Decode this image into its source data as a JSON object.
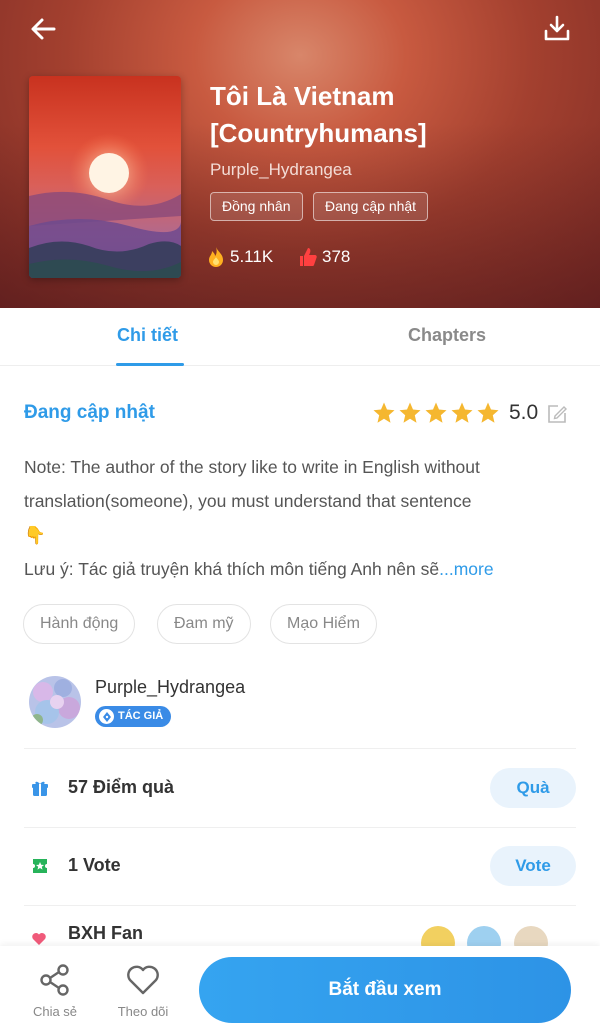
{
  "header": {
    "back_icon": "arrow-left-icon",
    "download_icon": "download-icon",
    "title_line1": "Tôi Là Vietnam",
    "title_line2": "[Countryhumans]",
    "author": "Purple_Hydrangea",
    "tags": [
      "Đồng nhân",
      "Đang cập nhật"
    ],
    "views": "5.11K",
    "likes": "378"
  },
  "tabs": {
    "details": "Chi tiết",
    "chapters": "Chapters",
    "active": "Chi tiết"
  },
  "detail": {
    "status": "Đang cập nhật",
    "stars": 5,
    "rating": "5.0",
    "desc_line1": "Note: The author of the story like to write in English without",
    "desc_line2": "translation(someone), you must understand that sentence",
    "desc_emoji": "👇",
    "desc_line4": "Lưu ý: Tác giả truyện khá thích môn tiếng Anh nên sẽ",
    "more": "...more",
    "genres": [
      "Hành động",
      "Đam mỹ",
      "Mạo Hiểm"
    ]
  },
  "author_card": {
    "name": "Purple_Hydrangea",
    "badge": "TÁC GIẢ"
  },
  "rows": {
    "gift_label": "57 Điểm quà",
    "gift_button": "Quà",
    "vote_label": "1 Vote",
    "vote_button": "Vote",
    "fan_label": "BXH Fan"
  },
  "bottom_bar": {
    "share": "Chia sẻ",
    "follow": "Theo dõi",
    "start": "Bắt đầu xem"
  },
  "colors": {
    "accent": "#2f9be8",
    "hero": "#a3402f",
    "star": "#f5b730"
  }
}
